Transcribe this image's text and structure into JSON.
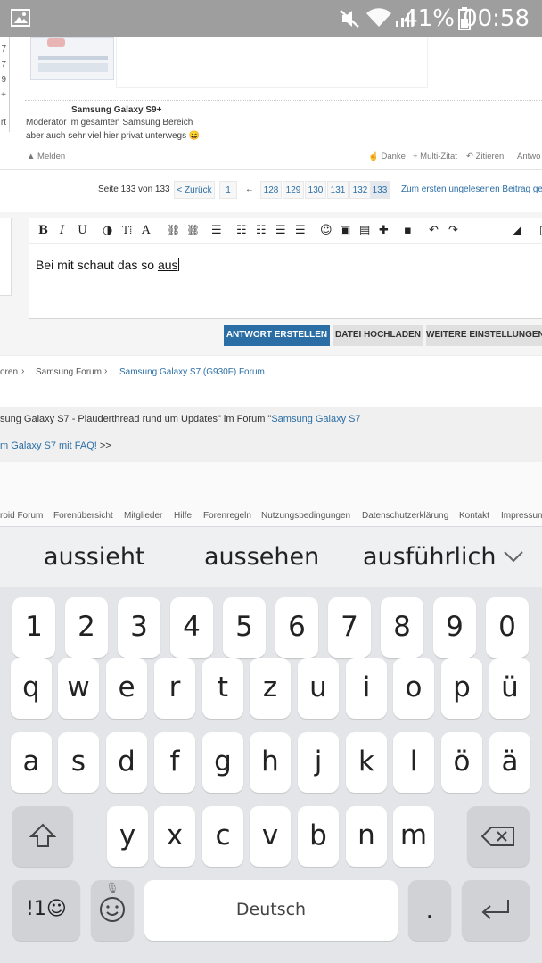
{
  "status_bar": {
    "battery_percent": "41%",
    "time": "00:58"
  },
  "post": {
    "left_numbers": [
      "7",
      "7",
      "9",
      "+",
      "rt"
    ],
    "signature_title": "Samsung Galaxy S9+",
    "signature_line1": "Moderator im gesamten Samsung Bereich",
    "signature_line2": "aber auch sehr viel hier privat unterwegs 😄",
    "report_label": "Melden",
    "thanks_label": "Danke",
    "multiquote_label": "+ Multi-Zitat",
    "quote_label": "Zitieren",
    "reply_label": "Antwo"
  },
  "pagination": {
    "label": "Seite 133 von 133",
    "back": "< Zurück",
    "first": "1",
    "arrow": "←",
    "pages": [
      "128",
      "129",
      "130",
      "131",
      "132",
      "133"
    ],
    "first_unread": "Zum ersten ungelesenen Beitrag ge"
  },
  "editor": {
    "text_prefix": "Bei mit schaut das so ",
    "text_composing": "aus",
    "submit_label": "ANTWORT ERSTELLEN",
    "upload_label": "DATEI HOCHLADEN",
    "more_label": "WEITERE EINSTELLUNGEN"
  },
  "breadcrumb": {
    "item1": "oren",
    "item2": "Samsung Forum",
    "item3": "Samsung Galaxy S7 (G930F) Forum"
  },
  "info": {
    "line1_prefix": "sung Galaxy S7 - Plauderthread rund um Updates\" im Forum \"",
    "line1_link": "Samsung Galaxy S7",
    "line2_link": "m Galaxy S7 mit FAQ!",
    "line2_suffix": " >>"
  },
  "footer": [
    "roid Forum",
    "Forenübersicht",
    "Mitglieder",
    "Hilfe",
    "Forenregeln",
    "Nutzungsbedingungen",
    "Datenschutzerklärung",
    "Kontakt",
    "Impressum"
  ],
  "keyboard": {
    "suggestions": [
      "aussieht",
      "aussehen",
      "ausführlich"
    ],
    "numbers": [
      "1",
      "2",
      "3",
      "4",
      "5",
      "6",
      "7",
      "8",
      "9",
      "0"
    ],
    "row1": [
      "q",
      "w",
      "e",
      "r",
      "t",
      "z",
      "u",
      "i",
      "o",
      "p",
      "ü"
    ],
    "row2": [
      "a",
      "s",
      "d",
      "f",
      "g",
      "h",
      "j",
      "k",
      "l",
      "ö",
      "ä"
    ],
    "row3": [
      "y",
      "x",
      "c",
      "v",
      "b",
      "n",
      "m"
    ],
    "symbols_label": "!1☺",
    "space_label": "Deutsch",
    "period_label": "."
  },
  "colors": {
    "accent": "#2b6ea5",
    "status_bar": "#9e9e9e",
    "keyboard_bg": "#e4e5e8"
  }
}
